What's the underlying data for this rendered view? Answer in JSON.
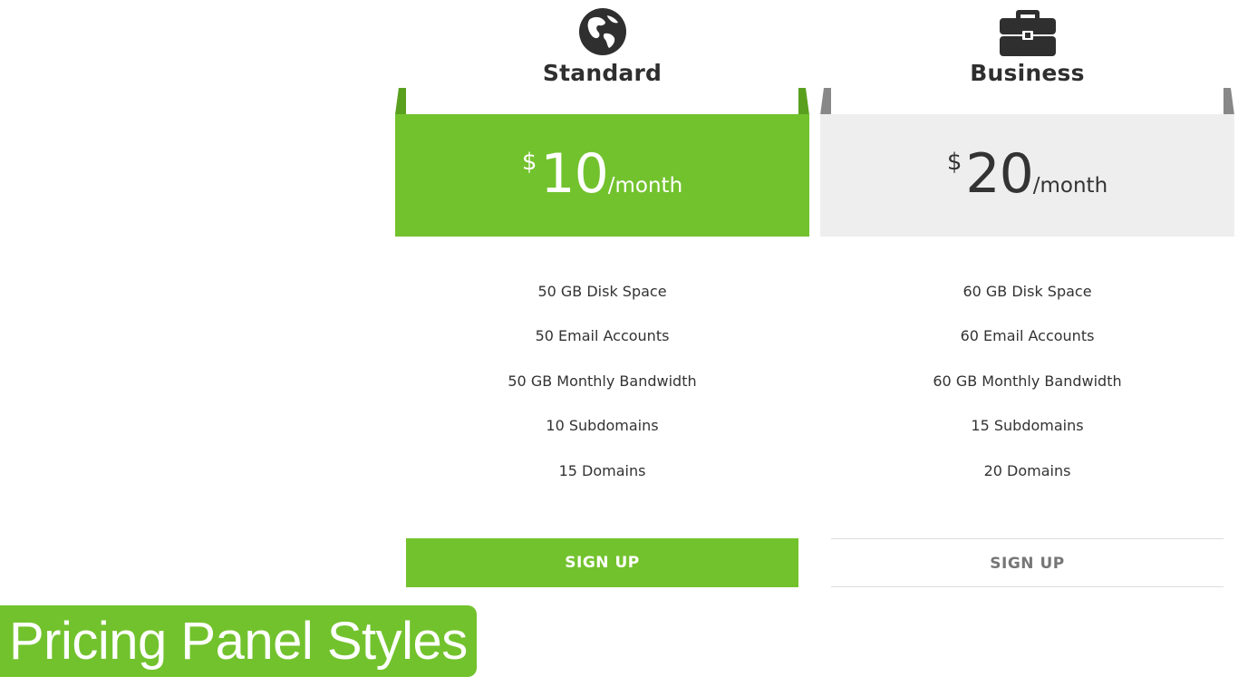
{
  "plans": [
    {
      "name": "Standard",
      "icon": "globe-icon",
      "currency": "$",
      "amount": "10",
      "period": "/month",
      "features": [
        "50 GB Disk Space",
        "50 Email Accounts",
        "50 GB Monthly Bandwidth",
        "10 Subdomains",
        "15 Domains"
      ],
      "button_label": "SIGN UP",
      "accent_color": "#72c22d"
    },
    {
      "name": "Business",
      "icon": "briefcase-icon",
      "currency": "$",
      "amount": "20",
      "period": "/month",
      "features": [
        "60 GB Disk Space",
        "60 Email Accounts",
        "60 GB Monthly Bandwidth",
        "15 Subdomains",
        "20 Domains"
      ],
      "button_label": "SIGN UP",
      "accent_color": "#eeeeee"
    }
  ],
  "caption": "Pricing Panel Styles",
  "colors": {
    "brand_green": "#72c22d",
    "tab_green": "#5aa01f",
    "tab_gray": "#888888",
    "text_dark": "#333333"
  }
}
